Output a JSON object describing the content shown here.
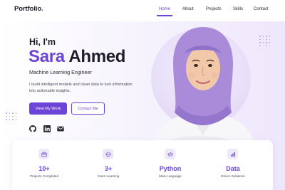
{
  "brand": {
    "logo_text": "Portfolio",
    "logo_dot": "."
  },
  "nav": {
    "items": [
      {
        "label": "Home",
        "active": true
      },
      {
        "label": "About",
        "active": false
      },
      {
        "label": "Projects",
        "active": false
      },
      {
        "label": "Skills",
        "active": false
      },
      {
        "label": "Contact",
        "active": false
      }
    ]
  },
  "hero": {
    "greeting": "Hi, I'm",
    "first_name": "Sara",
    "last_name": "Ahmed",
    "role": "Machine Learning Engineer",
    "description": "I build intelligent models and clean data to turn information into actionable insights.",
    "primary_button": "View My Work",
    "secondary_button": "Contact Me",
    "social_icons": [
      "github-icon",
      "linkedin-icon",
      "email-icon"
    ]
  },
  "stats": [
    {
      "icon": "briefcase-icon",
      "value": "10+",
      "label": "Projects Completed"
    },
    {
      "icon": "graduation-cap-icon",
      "value": "3+",
      "label": "Years Learning"
    },
    {
      "icon": "code-icon",
      "value": "Python",
      "label": "Main Language"
    },
    {
      "icon": "database-icon",
      "value": "Data",
      "label": "Driven Solutions"
    }
  ],
  "colors": {
    "accent": "#6c45d8",
    "text": "#1f1d2b",
    "hijab": "#a98bd9",
    "background_tint": "#f3effc"
  }
}
